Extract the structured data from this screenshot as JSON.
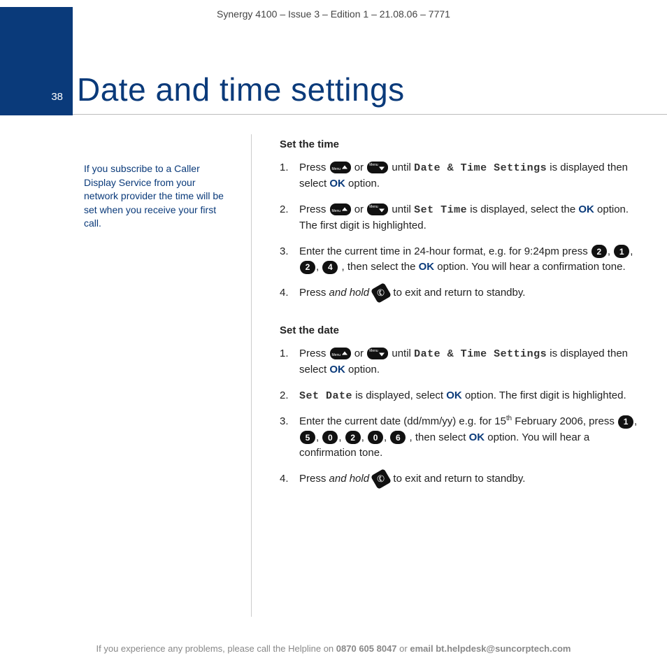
{
  "header": "Synergy 4100 – Issue 3 – Edition 1 – 21.08.06 – 7771",
  "page_number": "38",
  "title": "Date and time settings",
  "sidebar_note": "If you subscribe to a Caller Display Service from your network provider the time will be set when you receive your first call.",
  "set_time": {
    "heading": "Set the time",
    "step1_a": "Press ",
    "step1_b": " or ",
    "step1_c": " until ",
    "step1_lcd": "Date & Time Settings",
    "step1_d": " is displayed then select ",
    "ok": "OK",
    "step1_e": " option.",
    "step2_a": "Press ",
    "step2_b": " or ",
    "step2_c": " until ",
    "step2_lcd": "Set Time",
    "step2_d": " is displayed, select the ",
    "step2_e": " option. The first digit is highlighted.",
    "step3_a": "Enter the current time in 24-hour format, e.g. for 9:24pm press ",
    "btn_2a": "2",
    "btn_1": "1",
    "btn_2b": "2",
    "btn_4": "4",
    "comma": ", ",
    "step3_b": ", then select the ",
    "step3_c": " option. You will hear a confirmation tone.",
    "step4_a": "Press ",
    "step4_em": "and hold",
    "step4_b": " to exit and return to standby."
  },
  "set_date": {
    "heading": "Set the date",
    "step1_a": "Press ",
    "step1_b": " or ",
    "step1_c": " until ",
    "step1_lcd": "Date & Time Settings",
    "step1_d": " is displayed then select ",
    "step1_e": " option.",
    "step2_lcd": "Set Date",
    "step2_a": " is displayed, select ",
    "step2_b": " option. The first digit is highlighted.",
    "step3_a": "Enter the current date (dd/mm/yy) e.g. for 15",
    "step3_sup": "th",
    "step3_b": " February 2006, press ",
    "btn_1": "1",
    "btn_5": "5",
    "btn_0a": "0",
    "btn_2": "2",
    "btn_0b": "0",
    "btn_6": "6",
    "step3_c": ", then select ",
    "step3_d": " option. You will hear a confirmation tone.",
    "step4_a": "Press ",
    "step4_em": "and hold",
    "step4_b": " to exit and return to standby."
  },
  "footer": {
    "a": "If you experience any problems, please call the Helpline on ",
    "phone": "0870 605 8047",
    "b": " or ",
    "email_label": "email bt.helpdesk@suncorptech.com"
  }
}
